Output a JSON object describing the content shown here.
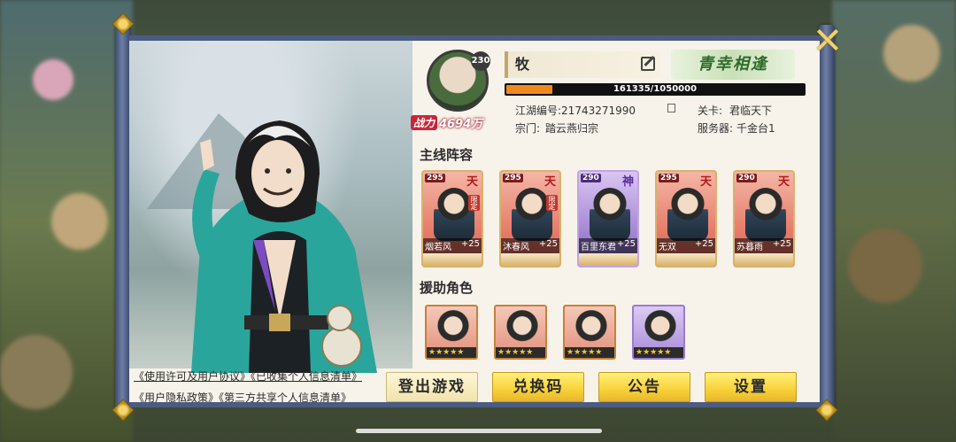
{
  "player": {
    "level": "230",
    "name": "牧",
    "power_tag": "战力",
    "power_value": "4694万",
    "motto": "青幸相逢",
    "exp_current": 161335,
    "exp_max": 1050000,
    "exp_text": "161335/1050000",
    "jianghu_id_label": "江湖编号:",
    "jianghu_id": "21743271990",
    "sect_label": "宗门:",
    "sect": "踏云燕归宗",
    "stage_label": "关卡:",
    "stage": "君临天下",
    "server_label": "服务器:",
    "server": "千金台1"
  },
  "main_lineup": {
    "title": "主线阵容",
    "heroes": [
      {
        "level": "295",
        "rank": "天",
        "limited": "限定",
        "name": "烟若风",
        "bonus": "+25",
        "tone": "red"
      },
      {
        "level": "295",
        "rank": "天",
        "limited": "限定",
        "name": "沐春风",
        "bonus": "+25",
        "tone": "red"
      },
      {
        "level": "290",
        "rank": "神",
        "limited": "",
        "name": "百里东君",
        "bonus": "+25",
        "tone": "purple"
      },
      {
        "level": "295",
        "rank": "天",
        "limited": "",
        "name": "无双",
        "bonus": "+25",
        "tone": "red"
      },
      {
        "level": "290",
        "rank": "天",
        "limited": "",
        "name": "苏暮雨",
        "bonus": "+25",
        "tone": "red"
      }
    ]
  },
  "support": {
    "title": "援助角色",
    "members": [
      {
        "stars": "★★★★★",
        "tone": "red"
      },
      {
        "stars": "★★★★★",
        "tone": "red"
      },
      {
        "stars": "★★★★★",
        "tone": "red"
      },
      {
        "stars": "★★★★★",
        "tone": "purple"
      }
    ]
  },
  "links": {
    "line1": "《使用许可及用户协议》《已收集个人信息清单》",
    "line2": "《用户隐私政策》《第三方共享个人信息清单》"
  },
  "buttons": {
    "logout": "登出游戏",
    "redeem": "兑换码",
    "notice": "公告",
    "settings": "设置"
  },
  "colors": {
    "accent": "#f9d43c",
    "exp_fill": "#f08a1c",
    "frame": "#4b5b82",
    "panel": "#f7f3ea"
  }
}
